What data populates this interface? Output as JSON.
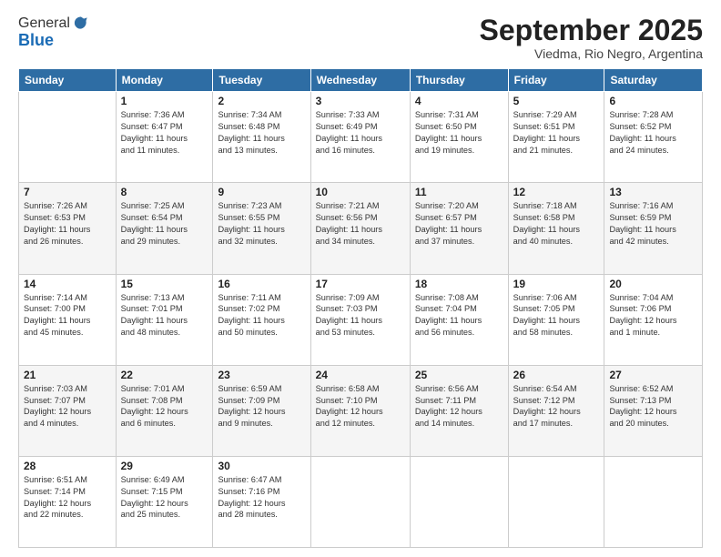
{
  "logo": {
    "line1": "General",
    "line2": "Blue"
  },
  "title": "September 2025",
  "subtitle": "Viedma, Rio Negro, Argentina",
  "days_header": [
    "Sunday",
    "Monday",
    "Tuesday",
    "Wednesday",
    "Thursday",
    "Friday",
    "Saturday"
  ],
  "weeks": [
    [
      {
        "num": "",
        "info": ""
      },
      {
        "num": "1",
        "info": "Sunrise: 7:36 AM\nSunset: 6:47 PM\nDaylight: 11 hours\nand 11 minutes."
      },
      {
        "num": "2",
        "info": "Sunrise: 7:34 AM\nSunset: 6:48 PM\nDaylight: 11 hours\nand 13 minutes."
      },
      {
        "num": "3",
        "info": "Sunrise: 7:33 AM\nSunset: 6:49 PM\nDaylight: 11 hours\nand 16 minutes."
      },
      {
        "num": "4",
        "info": "Sunrise: 7:31 AM\nSunset: 6:50 PM\nDaylight: 11 hours\nand 19 minutes."
      },
      {
        "num": "5",
        "info": "Sunrise: 7:29 AM\nSunset: 6:51 PM\nDaylight: 11 hours\nand 21 minutes."
      },
      {
        "num": "6",
        "info": "Sunrise: 7:28 AM\nSunset: 6:52 PM\nDaylight: 11 hours\nand 24 minutes."
      }
    ],
    [
      {
        "num": "7",
        "info": "Sunrise: 7:26 AM\nSunset: 6:53 PM\nDaylight: 11 hours\nand 26 minutes."
      },
      {
        "num": "8",
        "info": "Sunrise: 7:25 AM\nSunset: 6:54 PM\nDaylight: 11 hours\nand 29 minutes."
      },
      {
        "num": "9",
        "info": "Sunrise: 7:23 AM\nSunset: 6:55 PM\nDaylight: 11 hours\nand 32 minutes."
      },
      {
        "num": "10",
        "info": "Sunrise: 7:21 AM\nSunset: 6:56 PM\nDaylight: 11 hours\nand 34 minutes."
      },
      {
        "num": "11",
        "info": "Sunrise: 7:20 AM\nSunset: 6:57 PM\nDaylight: 11 hours\nand 37 minutes."
      },
      {
        "num": "12",
        "info": "Sunrise: 7:18 AM\nSunset: 6:58 PM\nDaylight: 11 hours\nand 40 minutes."
      },
      {
        "num": "13",
        "info": "Sunrise: 7:16 AM\nSunset: 6:59 PM\nDaylight: 11 hours\nand 42 minutes."
      }
    ],
    [
      {
        "num": "14",
        "info": "Sunrise: 7:14 AM\nSunset: 7:00 PM\nDaylight: 11 hours\nand 45 minutes."
      },
      {
        "num": "15",
        "info": "Sunrise: 7:13 AM\nSunset: 7:01 PM\nDaylight: 11 hours\nand 48 minutes."
      },
      {
        "num": "16",
        "info": "Sunrise: 7:11 AM\nSunset: 7:02 PM\nDaylight: 11 hours\nand 50 minutes."
      },
      {
        "num": "17",
        "info": "Sunrise: 7:09 AM\nSunset: 7:03 PM\nDaylight: 11 hours\nand 53 minutes."
      },
      {
        "num": "18",
        "info": "Sunrise: 7:08 AM\nSunset: 7:04 PM\nDaylight: 11 hours\nand 56 minutes."
      },
      {
        "num": "19",
        "info": "Sunrise: 7:06 AM\nSunset: 7:05 PM\nDaylight: 11 hours\nand 58 minutes."
      },
      {
        "num": "20",
        "info": "Sunrise: 7:04 AM\nSunset: 7:06 PM\nDaylight: 12 hours\nand 1 minute."
      }
    ],
    [
      {
        "num": "21",
        "info": "Sunrise: 7:03 AM\nSunset: 7:07 PM\nDaylight: 12 hours\nand 4 minutes."
      },
      {
        "num": "22",
        "info": "Sunrise: 7:01 AM\nSunset: 7:08 PM\nDaylight: 12 hours\nand 6 minutes."
      },
      {
        "num": "23",
        "info": "Sunrise: 6:59 AM\nSunset: 7:09 PM\nDaylight: 12 hours\nand 9 minutes."
      },
      {
        "num": "24",
        "info": "Sunrise: 6:58 AM\nSunset: 7:10 PM\nDaylight: 12 hours\nand 12 minutes."
      },
      {
        "num": "25",
        "info": "Sunrise: 6:56 AM\nSunset: 7:11 PM\nDaylight: 12 hours\nand 14 minutes."
      },
      {
        "num": "26",
        "info": "Sunrise: 6:54 AM\nSunset: 7:12 PM\nDaylight: 12 hours\nand 17 minutes."
      },
      {
        "num": "27",
        "info": "Sunrise: 6:52 AM\nSunset: 7:13 PM\nDaylight: 12 hours\nand 20 minutes."
      }
    ],
    [
      {
        "num": "28",
        "info": "Sunrise: 6:51 AM\nSunset: 7:14 PM\nDaylight: 12 hours\nand 22 minutes."
      },
      {
        "num": "29",
        "info": "Sunrise: 6:49 AM\nSunset: 7:15 PM\nDaylight: 12 hours\nand 25 minutes."
      },
      {
        "num": "30",
        "info": "Sunrise: 6:47 AM\nSunset: 7:16 PM\nDaylight: 12 hours\nand 28 minutes."
      },
      {
        "num": "",
        "info": ""
      },
      {
        "num": "",
        "info": ""
      },
      {
        "num": "",
        "info": ""
      },
      {
        "num": "",
        "info": ""
      }
    ]
  ]
}
